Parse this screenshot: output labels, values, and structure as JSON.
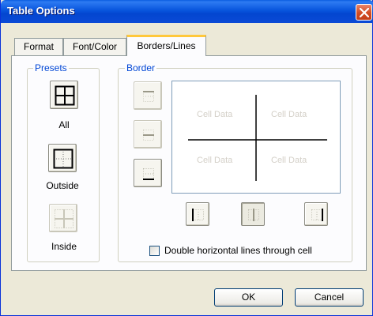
{
  "window": {
    "title": "Table Options"
  },
  "tabs": [
    {
      "label": "Format"
    },
    {
      "label": "Font/Color"
    },
    {
      "label": "Borders/Lines"
    }
  ],
  "presets": {
    "legend": "Presets",
    "items": [
      {
        "label": "All"
      },
      {
        "label": "Outside"
      },
      {
        "label": "Inside"
      }
    ]
  },
  "border": {
    "legend": "Border",
    "preview_cells": [
      "Cell Data",
      "Cell Data",
      "Cell Data",
      "Cell Data"
    ]
  },
  "double_lines": {
    "label": "Double horizontal lines through cell",
    "checked": false
  },
  "buttons": {
    "ok": "OK",
    "cancel": "Cancel"
  },
  "colors": {
    "titlebar": "#0855dd",
    "dialog_bg": "#ece9d8",
    "legend_text": "#0046d5",
    "active_tab_highlight": "#ffc83c",
    "close_button": "#d24b22"
  }
}
